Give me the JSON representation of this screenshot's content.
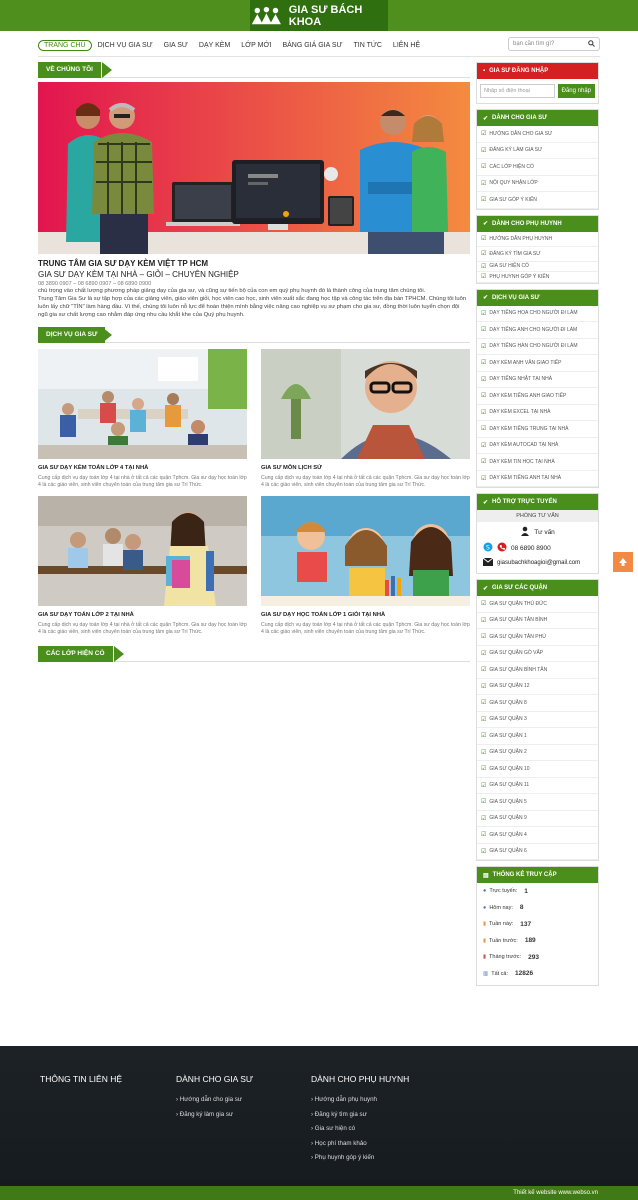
{
  "brand": {
    "name": "GIA SƯ BÁCH KHOA"
  },
  "nav": {
    "items": [
      "TRANG CHỦ",
      "DỊCH VỤ GIA SƯ",
      "GIA SƯ",
      "DẠY KÈM",
      "LỚP MỚI",
      "BẢNG GIÁ GIA SƯ",
      "TIN TỨC",
      "LIÊN HỆ"
    ],
    "search_placeholder": "bạn cần tìm gì?"
  },
  "about": {
    "heading": "VỀ CHÚNG TÔI",
    "title": "TRUNG TÂM GIA SƯ DẠY KÈM VIỆT TP HCM",
    "subtitle": "GIA SƯ DẠY KÈM TẠI NHÀ – GIỎI – CHUYÊN NGHIỆP",
    "phones": "08 3890 0907 – 08 6890 0907 – 08 6890 0900",
    "p1": "chú trọng vào chất lượng phương pháp giảng dạy của gia sư, và cũng sự tiến bộ của con em quý phụ huynh đó là thành công của trung tâm chúng tôi.",
    "p2": "Trung Tâm Gia Sư là sự tập hợp của các giảng viên, giáo viên giỏi, học viên cao học, sinh viên xuất sắc đang học tập và công tác trên địa bàn TPHCM. Chúng tôi luôn luôn lấy chữ \"TÍN\" làm hàng đầu. Vì thế, chúng tôi luôn nỗ lực để hoàn thiện mình bằng việc nâng cao nghiệp vụ sư phạm cho gia sư, đồng thời luôn tuyển chọn đội ngũ gia sư chất lượng cao nhằm đáp ứng nhu cầu khắt khe của Quý phụ huynh."
  },
  "services": {
    "heading": "DỊCH VỤ GIA SƯ",
    "cards": [
      {
        "title": "GIA SƯ DẠY KÈM TOÁN LỚP 4 TẠI NHÀ",
        "desc": "Cung cấp dịch vụ dạy toán lớp 4 tại nhà ở tất cả các quận Tphcm. Gia sư dạy học toán lớp 4 là các giáo viên, sinh viên chuyên toán của trung tâm gia sư Trí Thức."
      },
      {
        "title": "GIA SƯ MÔN LỊCH SỬ",
        "desc": "Cung cấp dịch vụ dạy toán lớp 4 tại nhà ở tất cả các quận Tphcm. Gia sư dạy học toán lớp 4 là các giáo viên, sinh viên chuyên toán của trung tâm gia sư Trí Thức."
      },
      {
        "title": "GIA SƯ DẠY TOÁN LỚP 2 TẠI NHÀ",
        "desc": "Cung cấp dịch vụ dạy toán lớp 4 tại nhà ở tất cả các quận Tphcm. Gia sư dạy học toán lớp 4 là các giáo viên, sinh viên chuyên toán của trung tâm gia sư Trí Thức."
      },
      {
        "title": "GIA SƯ DẠY HỌC TOÁN LỚP 1 GIỎI TẠI NHÀ",
        "desc": "Cung cấp dịch vụ dạy toán lớp 4 tại nhà ở tất cả các quận Tphcm. Gia sư dạy học toán lớp 4 là các giáo viên, sinh viên chuyên toán của trung tâm gia sư Trí Thức."
      }
    ]
  },
  "classes": {
    "heading": "CÁC LỚP HIỆN CÓ"
  },
  "sidebar": {
    "login": {
      "heading": "GIA SƯ ĐĂNG NHẬP",
      "placeholder": "Nhập số điện thoại",
      "button": "Đăng nhập"
    },
    "tutors": {
      "heading": "DÀNH CHO GIA SƯ",
      "items": [
        "HƯỚNG DẪN CHO GIA SƯ",
        "ĐĂNG KÝ LÀM GIA SƯ",
        "CÁC LỚP HIỆN CÓ",
        "NỘI QUY NHẬN LỚP",
        "GIA SƯ GÓP Ý KIẾN"
      ]
    },
    "parents": {
      "heading": "DÀNH CHO PHỤ HUYNH",
      "items": [
        "HƯỚNG DẪN PHỤ HUYNH",
        "ĐĂNG KÝ TÌM GIA SƯ",
        "GIA SƯ HIỆN CÓ",
        "PHỤ HUYNH GÓP Ý KIẾN"
      ]
    },
    "service_list": {
      "heading": "DỊCH VỤ GIA SƯ",
      "items": [
        "DẠY TIẾNG HOA CHO NGƯỜI ĐI LÀM",
        "DẠY TIẾNG ANH CHO NGƯỜI ĐI LÀM",
        "DẠY TIẾNG HÀN CHO NGƯỜI ĐI LÀM",
        "DẠY KÈM ANH VĂN GIAO TIẾP",
        "DẠY TIẾNG NHẬT TẠI NHÀ",
        "DẠY KÈM TIẾNG ANH GIAO TIẾP",
        "DẠY KÈM EXCEL TẠI NHÀ",
        "DẠY KÈM TIẾNG TRUNG TẠI NHÀ",
        "DẠY KÈM AUTOCAD TẠI NHÀ",
        "DẠY KÈM TIN HỌC TẠI NHÀ",
        "DẠY KÈM TIẾNG ANH TẠI NHÀ"
      ]
    },
    "support": {
      "heading": "HỖ TRỢ TRỰC TUYẾN",
      "subhead": "PHÒNG TƯ VẤN",
      "consult": "Tư vấn",
      "phone": "08 6890 8900",
      "email": "giasubachkhoagioi@gmail.com"
    },
    "districts": {
      "heading": "GIA SƯ CÁC QUẬN",
      "items": [
        "GIA SƯ QUẬN THỦ ĐỨC",
        "GIA SƯ QUẬN TÂN BÌNH",
        "GIA SƯ QUẬN TÂN PHÚ",
        "GIA SƯ QUẬN GÒ VẤP",
        "GIA SƯ QUẬN BÌNH TÂN",
        "GIA SƯ QUẬN 12",
        "GIA SƯ QUẬN 8",
        "GIA SƯ QUẬN 3",
        "GIA SƯ QUẬN 1",
        "GIA SƯ QUẬN 2",
        "GIA SƯ QUẬN 10",
        "GIA SƯ QUẬN 11",
        "GIA SƯ QUẬN 5",
        "GIA SƯ QUẬN 9",
        "GIA SƯ QUẬN 4",
        "GIA SƯ QUẬN 6"
      ]
    },
    "stats": {
      "heading": "THỐNG KÊ TRUY CẬP",
      "rows": [
        {
          "label": "Trực tuyến:",
          "value": "1"
        },
        {
          "label": "Hôm nay:",
          "value": "8"
        },
        {
          "label": "Tuần này:",
          "value": "137"
        },
        {
          "label": "Tuần trước:",
          "value": "189"
        },
        {
          "label": "Tháng trước:",
          "value": "293"
        },
        {
          "label": "Tất cả:",
          "value": "12826"
        }
      ]
    }
  },
  "footer": {
    "col1": {
      "heading": "THÔNG TIN LIÊN HỆ"
    },
    "col2": {
      "heading": "DÀNH CHO GIA SƯ",
      "items": [
        "Hướng dẫn cho gia sư",
        "Đăng ký làm gia sư"
      ]
    },
    "col3": {
      "heading": "DÀNH CHO PHỤ HUYNH",
      "items": [
        "Hướng dẫn phụ huynh",
        "Đăng ký tìm gia sư",
        "Gia sư hiện có",
        "Học phí tham khảo",
        "Phụ huynh góp ý kiến"
      ]
    },
    "credit": "Thiết kế website www.webso.vn"
  },
  "colors": {
    "green": "#4a8e1c",
    "dark_green": "#2f6f0f",
    "red": "#d42020",
    "orange": "#f28a43"
  },
  "icons": {
    "scroll_top": "arrow-up-icon",
    "search": "search-icon"
  }
}
